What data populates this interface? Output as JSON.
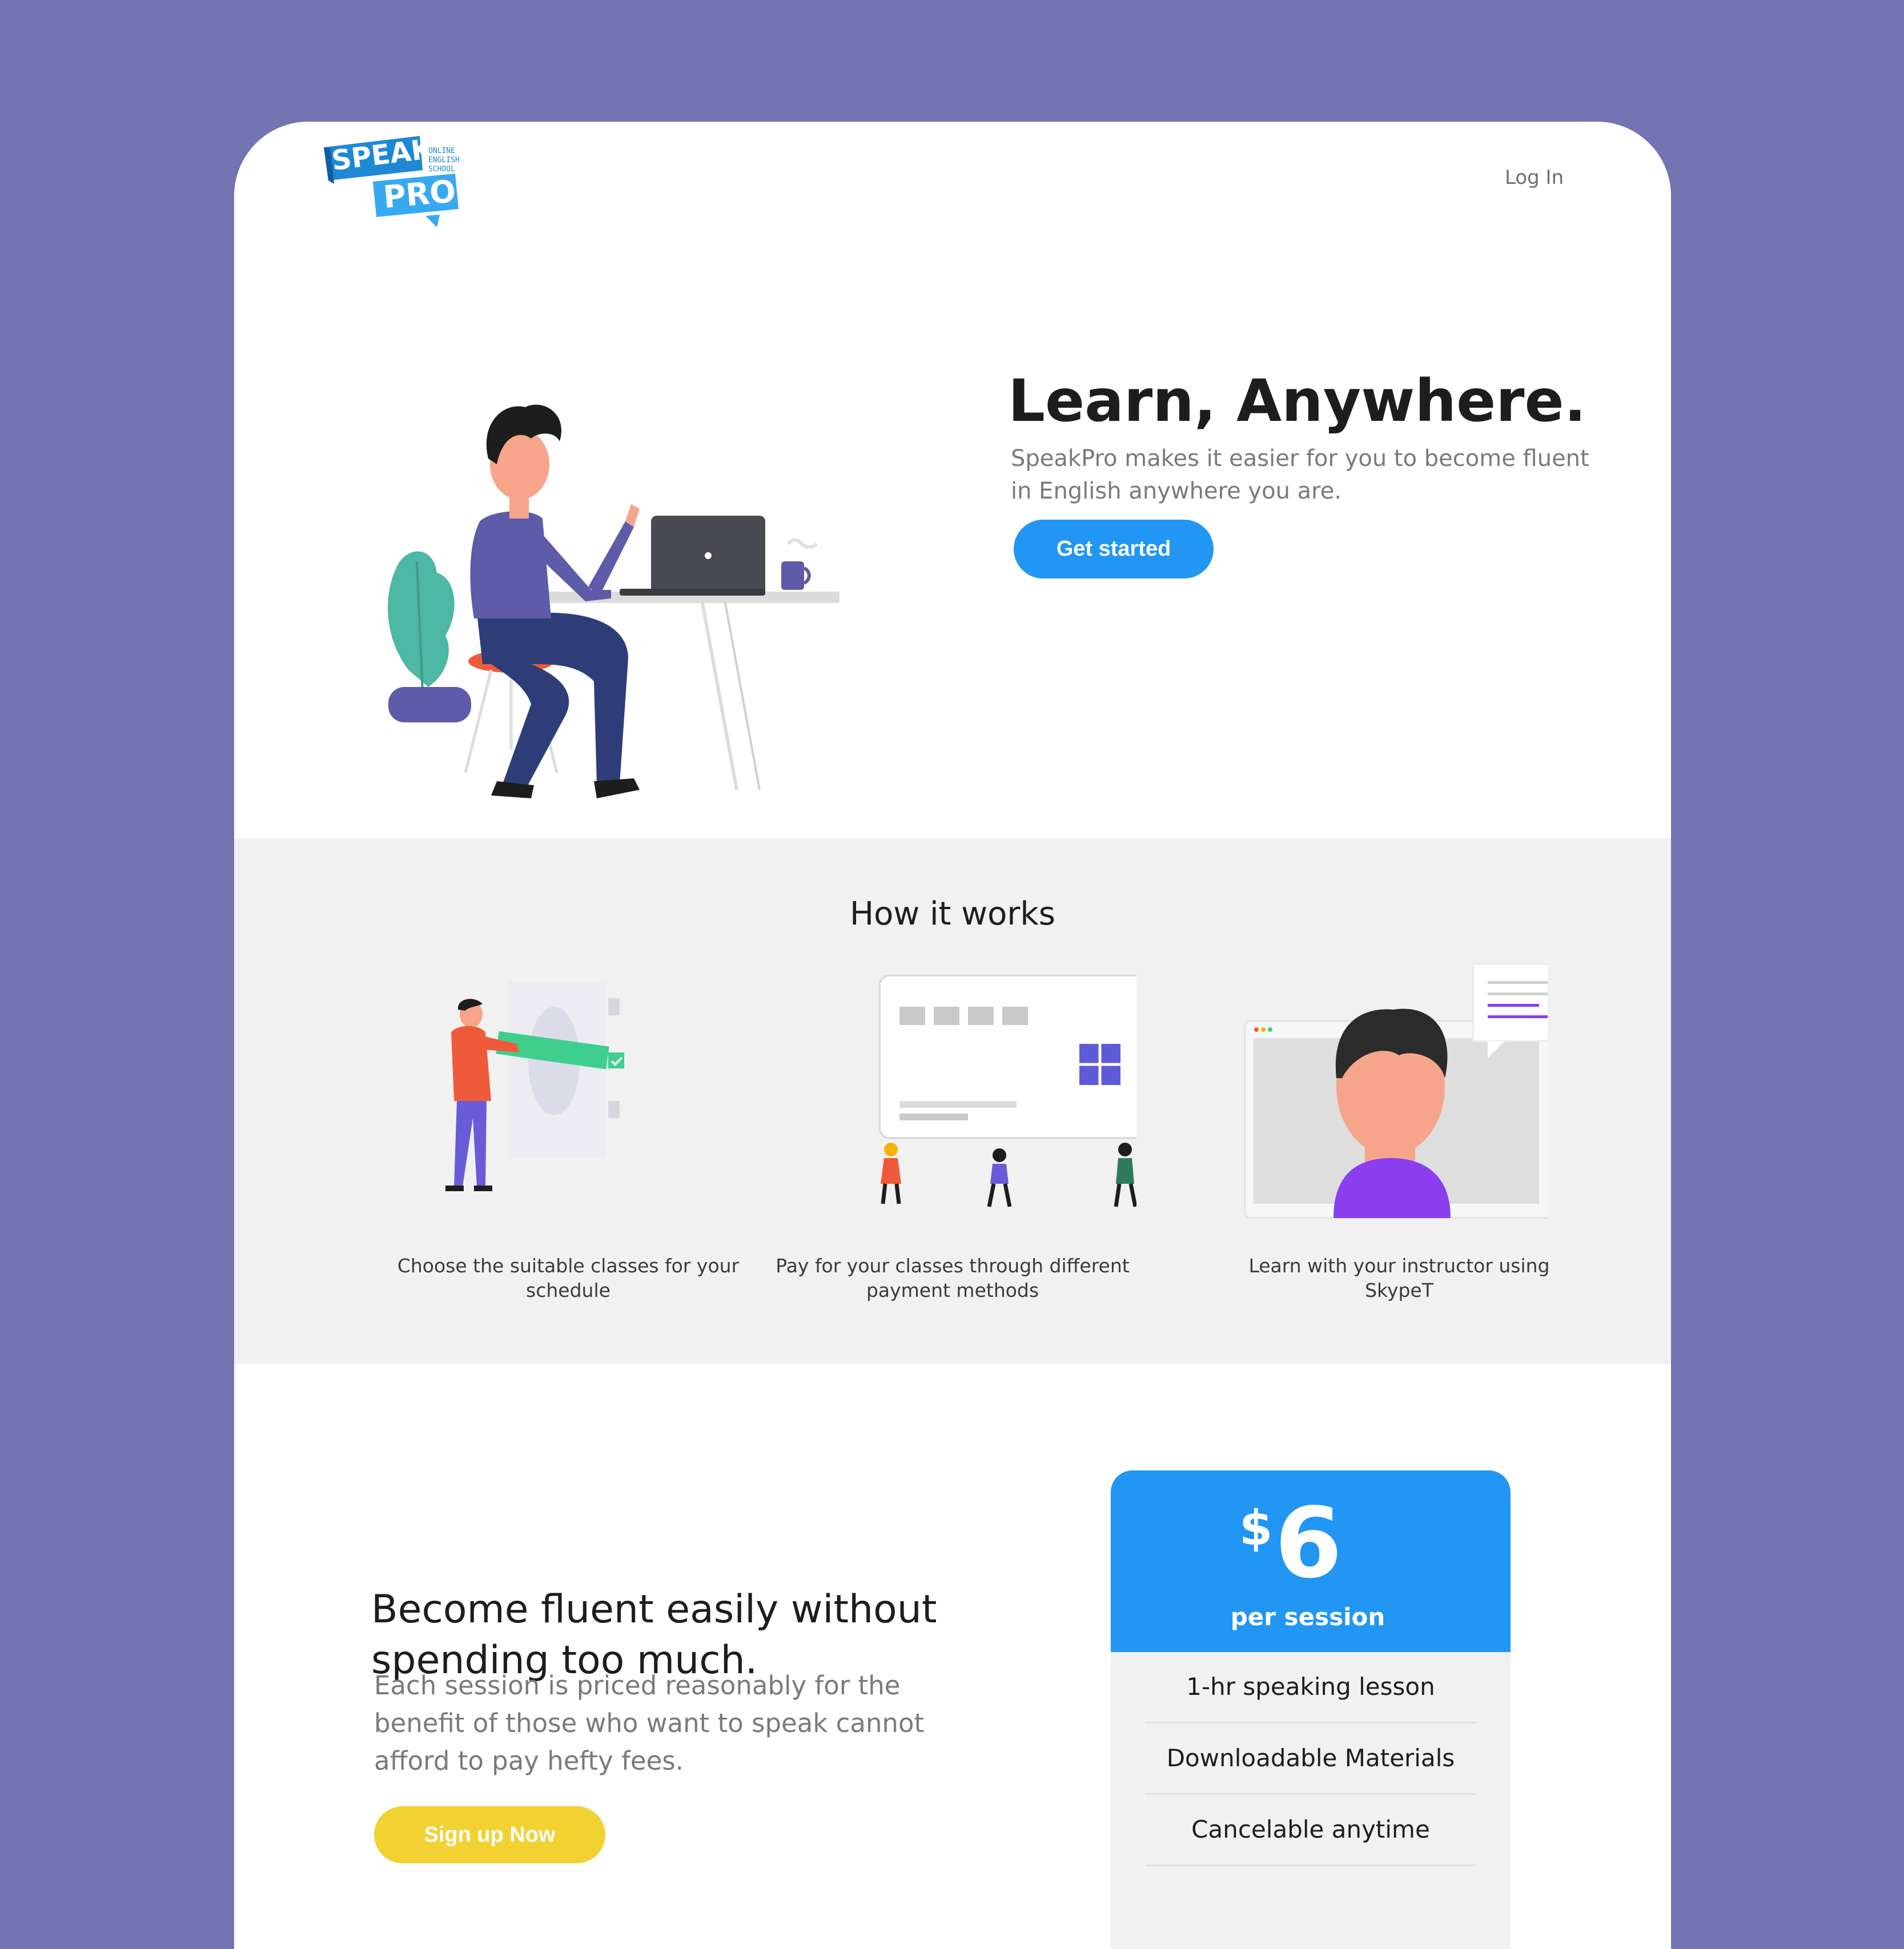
{
  "header": {
    "logo_word1": "SPEAK",
    "logo_word2": "PRO",
    "logo_tagline": [
      "ONLINE",
      "ENGLISH",
      "SCHOOL"
    ],
    "login_label": "Log In"
  },
  "hero": {
    "title": "Learn, Anywhere.",
    "subtitle": "SpeakPro makes it easier for you to become fluent in English anywhere you are.",
    "cta_label": "Get started"
  },
  "how_it_works": {
    "title": "How it works",
    "steps": [
      {
        "caption": "Choose the suitable classes for your schedule"
      },
      {
        "caption": "Pay for your classes through different payment methods"
      },
      {
        "caption": "Learn with your instructor using SkypeT"
      }
    ]
  },
  "pricing": {
    "title": "Become fluent easily without spending too much.",
    "subtitle": "Each session is priced reasonably for the benefit of those who want to speak cannot afford to pay hefty fees.",
    "cta_label": "Sign up Now",
    "card": {
      "currency": "$",
      "amount": "6",
      "period": "per session",
      "features": [
        "1-hr speaking lesson",
        "Downloadable Materials",
        "Cancelable anytime"
      ]
    }
  },
  "colors": {
    "background": "#7474b2",
    "primary": "#2196f3",
    "accent_yellow": "#f2d233",
    "section_gray": "#f1f1f1"
  }
}
